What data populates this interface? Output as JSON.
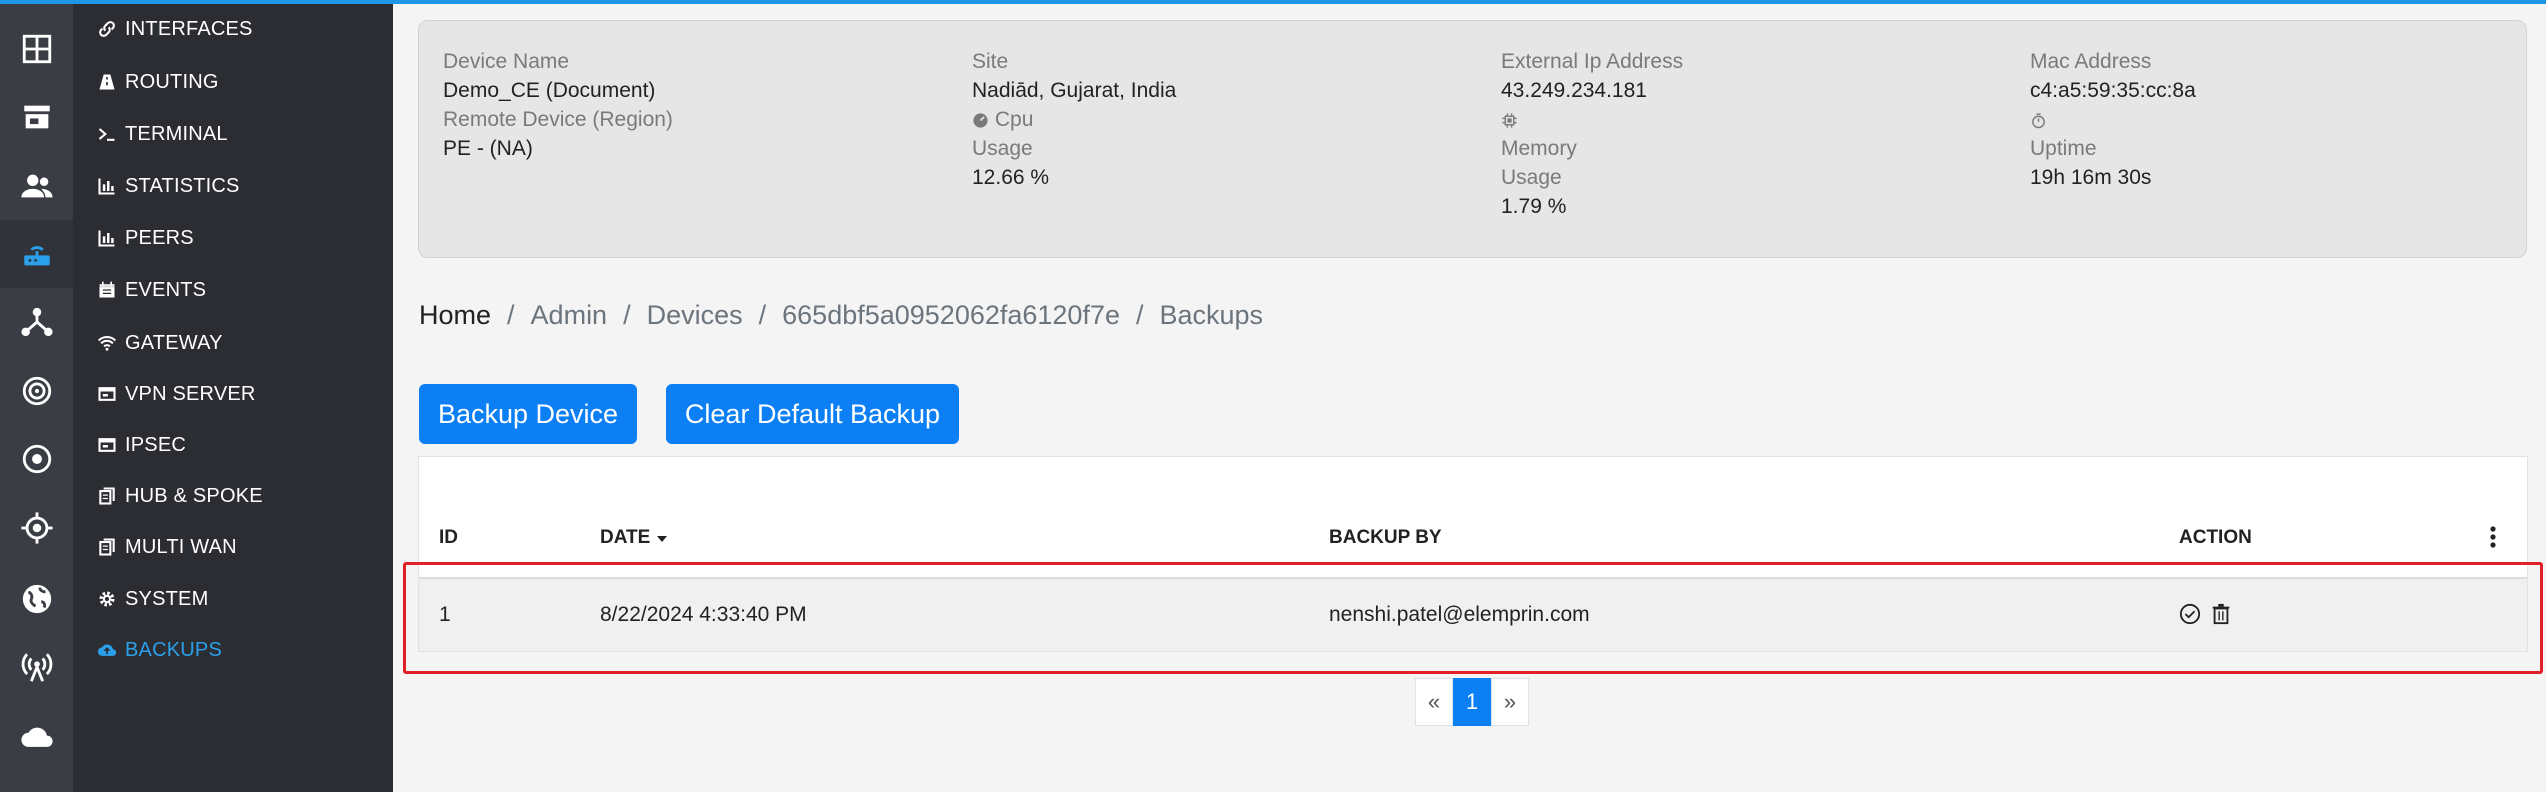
{
  "sidebar": {
    "rail_icons": [
      "dashboard-icon",
      "store-icon",
      "users-icon",
      "router-icon",
      "topology-icon",
      "radar-icon",
      "target-icon",
      "crosshair-icon",
      "globe-icon",
      "antenna-icon",
      "cloud-icon"
    ],
    "items": [
      {
        "label": "INTERFACES",
        "icon": "link-icon"
      },
      {
        "label": "ROUTING",
        "icon": "road-icon"
      },
      {
        "label": "TERMINAL",
        "icon": "terminal-icon"
      },
      {
        "label": "STATISTICS",
        "icon": "chart-icon"
      },
      {
        "label": "PEERS",
        "icon": "chart-icon"
      },
      {
        "label": "EVENTS",
        "icon": "calendar-icon"
      },
      {
        "label": "GATEWAY",
        "icon": "wifi-icon"
      },
      {
        "label": "VPN SERVER",
        "icon": "window-icon"
      },
      {
        "label": "IPSEC",
        "icon": "window-icon"
      },
      {
        "label": "HUB & SPOKE",
        "icon": "copy-icon"
      },
      {
        "label": "MULTI WAN",
        "icon": "copy-icon"
      },
      {
        "label": "SYSTEM",
        "icon": "gear-icon"
      },
      {
        "label": "BACKUPS",
        "icon": "cloud-upload-icon"
      }
    ]
  },
  "device": {
    "name_label": "Device Name",
    "name": "Demo_CE (Document)",
    "remote_label": "Remote Device (Region)",
    "remote": "PE - (NA)",
    "site_label": "Site",
    "site": "Nadiād, Gujarat, India",
    "cpu_label": "Cpu",
    "cpu_usage_label": "Usage",
    "cpu_usage": "12.66 %",
    "ext_ip_label": "External Ip Address",
    "ext_ip": "43.249.234.181",
    "memory_label": "Memory",
    "memory_usage_label": "Usage",
    "memory_usage": "1.79 %",
    "mac_label": "Mac Address",
    "mac": "c4:a5:59:35:cc:8a",
    "uptime_label": "Uptime",
    "uptime": "19h 16m 30s"
  },
  "breadcrumb": {
    "home": "Home",
    "admin": "Admin",
    "devices": "Devices",
    "device_id": "665dbf5a0952062fa6120f7e",
    "current": "Backups",
    "separator": "/"
  },
  "actions": {
    "backup_device": "Backup Device",
    "clear_default": "Clear Default Backup"
  },
  "table": {
    "headers": {
      "id": "ID",
      "date": "DATE",
      "backup_by": "BACKUP BY",
      "action": "ACTION"
    },
    "rows": [
      {
        "id": "1",
        "date": "8/22/2024 4:33:40 PM",
        "backup_by": "nenshi.patel@elemprin.com"
      }
    ]
  },
  "pagination": {
    "prev": "«",
    "current": "1",
    "next": "»"
  },
  "colors": {
    "accent": "#0d7ff5",
    "sidebar_active": "#2aa0ec",
    "highlight": "#e01f26"
  }
}
